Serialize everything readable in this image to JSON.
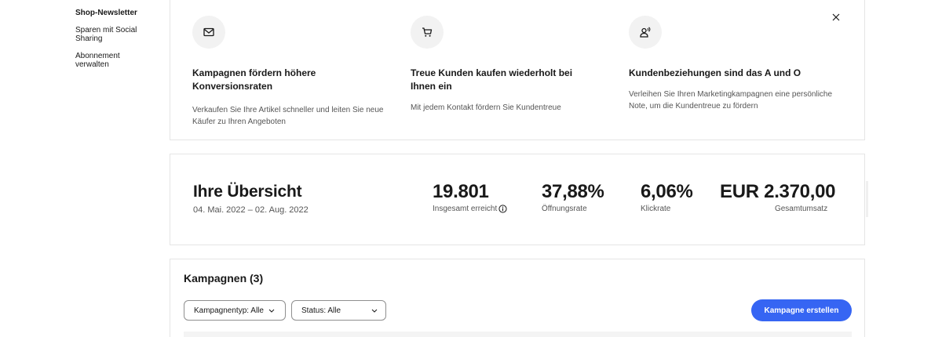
{
  "sidebar": {
    "items": [
      {
        "label": "Shop-Newsletter",
        "active": true
      },
      {
        "label": "Sparen mit Social Sharing",
        "active": false
      },
      {
        "label": "Abonnement verwalten",
        "active": false
      }
    ]
  },
  "benefits": [
    {
      "icon": "mail-icon",
      "title": "Kampagnen fördern höhere Konversionsraten",
      "desc": "Verkaufen Sie Ihre Artikel schneller und leiten Sie neue Käufer zu Ihren Angeboten"
    },
    {
      "icon": "cart-icon",
      "title": "Treue Kunden kaufen wiederholt bei Ihnen ein",
      "desc": "Mit jedem Kontakt fördern Sie Kundentreue"
    },
    {
      "icon": "customer-speak-icon",
      "title": "Kundenbeziehungen sind das A und O",
      "desc": "Verleihen Sie Ihren Marketingkampagnen eine persönliche Note, um die Kundentreue zu fördern"
    }
  ],
  "overview": {
    "title": "Ihre Übersicht",
    "date_range": "04. Mai. 2022 – 02. Aug. 2022",
    "metrics": [
      {
        "value": "19.801",
        "label": "Insgesamt erreicht",
        "info_icon": "info-icon"
      },
      {
        "value": "37,88%",
        "label": "Öffnungsrate"
      },
      {
        "value": "6,06%",
        "label": "Klickrate"
      },
      {
        "value": "EUR 2.370,00",
        "label": "Gesamtumsatz"
      }
    ]
  },
  "campaigns": {
    "title": "Kampagnen (3)",
    "filters": [
      {
        "label": "Kampagnentyp: Alle"
      },
      {
        "label": "Status: Alle"
      }
    ],
    "create_label": "Kampagne erstellen"
  },
  "colors": {
    "accent": "#3665f3",
    "text": "#191919",
    "muted": "#555555",
    "border": "#e5e5e5"
  }
}
